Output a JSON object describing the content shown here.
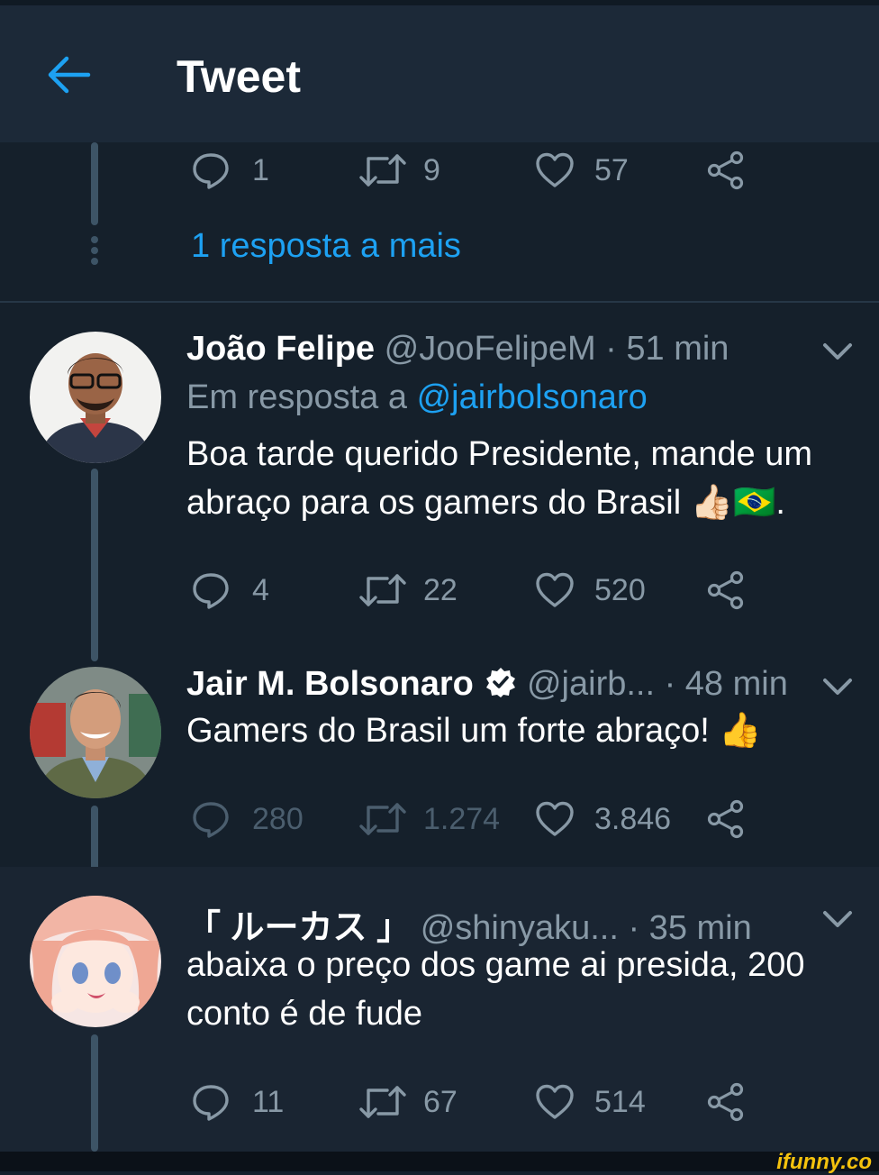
{
  "header": {
    "title": "Tweet"
  },
  "context_actions": {
    "replies": "1",
    "retweets": "9",
    "likes": "57"
  },
  "more_replies": "1 resposta a mais",
  "tweets": [
    {
      "name": "João Felipe",
      "handle": "@JooFelipeM · 51 min",
      "reply_prefix": "Em resposta a",
      "reply_handle": "@jairbolsonaro",
      "text_line1": "Boa tarde querido Presidente, mande um",
      "text_line2": "abraço para os gamers do Brasil 👍🏻🇧🇷.",
      "replies": "4",
      "retweets": "22",
      "likes": "520"
    },
    {
      "name": "Jair M. Bolsonaro",
      "handle": "@jairb... · 48 min",
      "text_line1": "Gamers do Brasil um forte abraço! 👍",
      "replies": "280",
      "retweets": "1.274",
      "likes": "3.846"
    },
    {
      "name": "「 ルーカス 」",
      "handle": "@shinyaku... · 35 min",
      "text_line1": "abaixa o preço dos game ai presida, 200",
      "text_line2": "conto é de fude",
      "replies": "11",
      "retweets": "67",
      "likes": "514"
    }
  ],
  "watermark": "ifunny.co",
  "colors": {
    "background": "#15202b",
    "header": "#1c2938",
    "accent": "#1da1f2",
    "muted": "#8899a6"
  }
}
